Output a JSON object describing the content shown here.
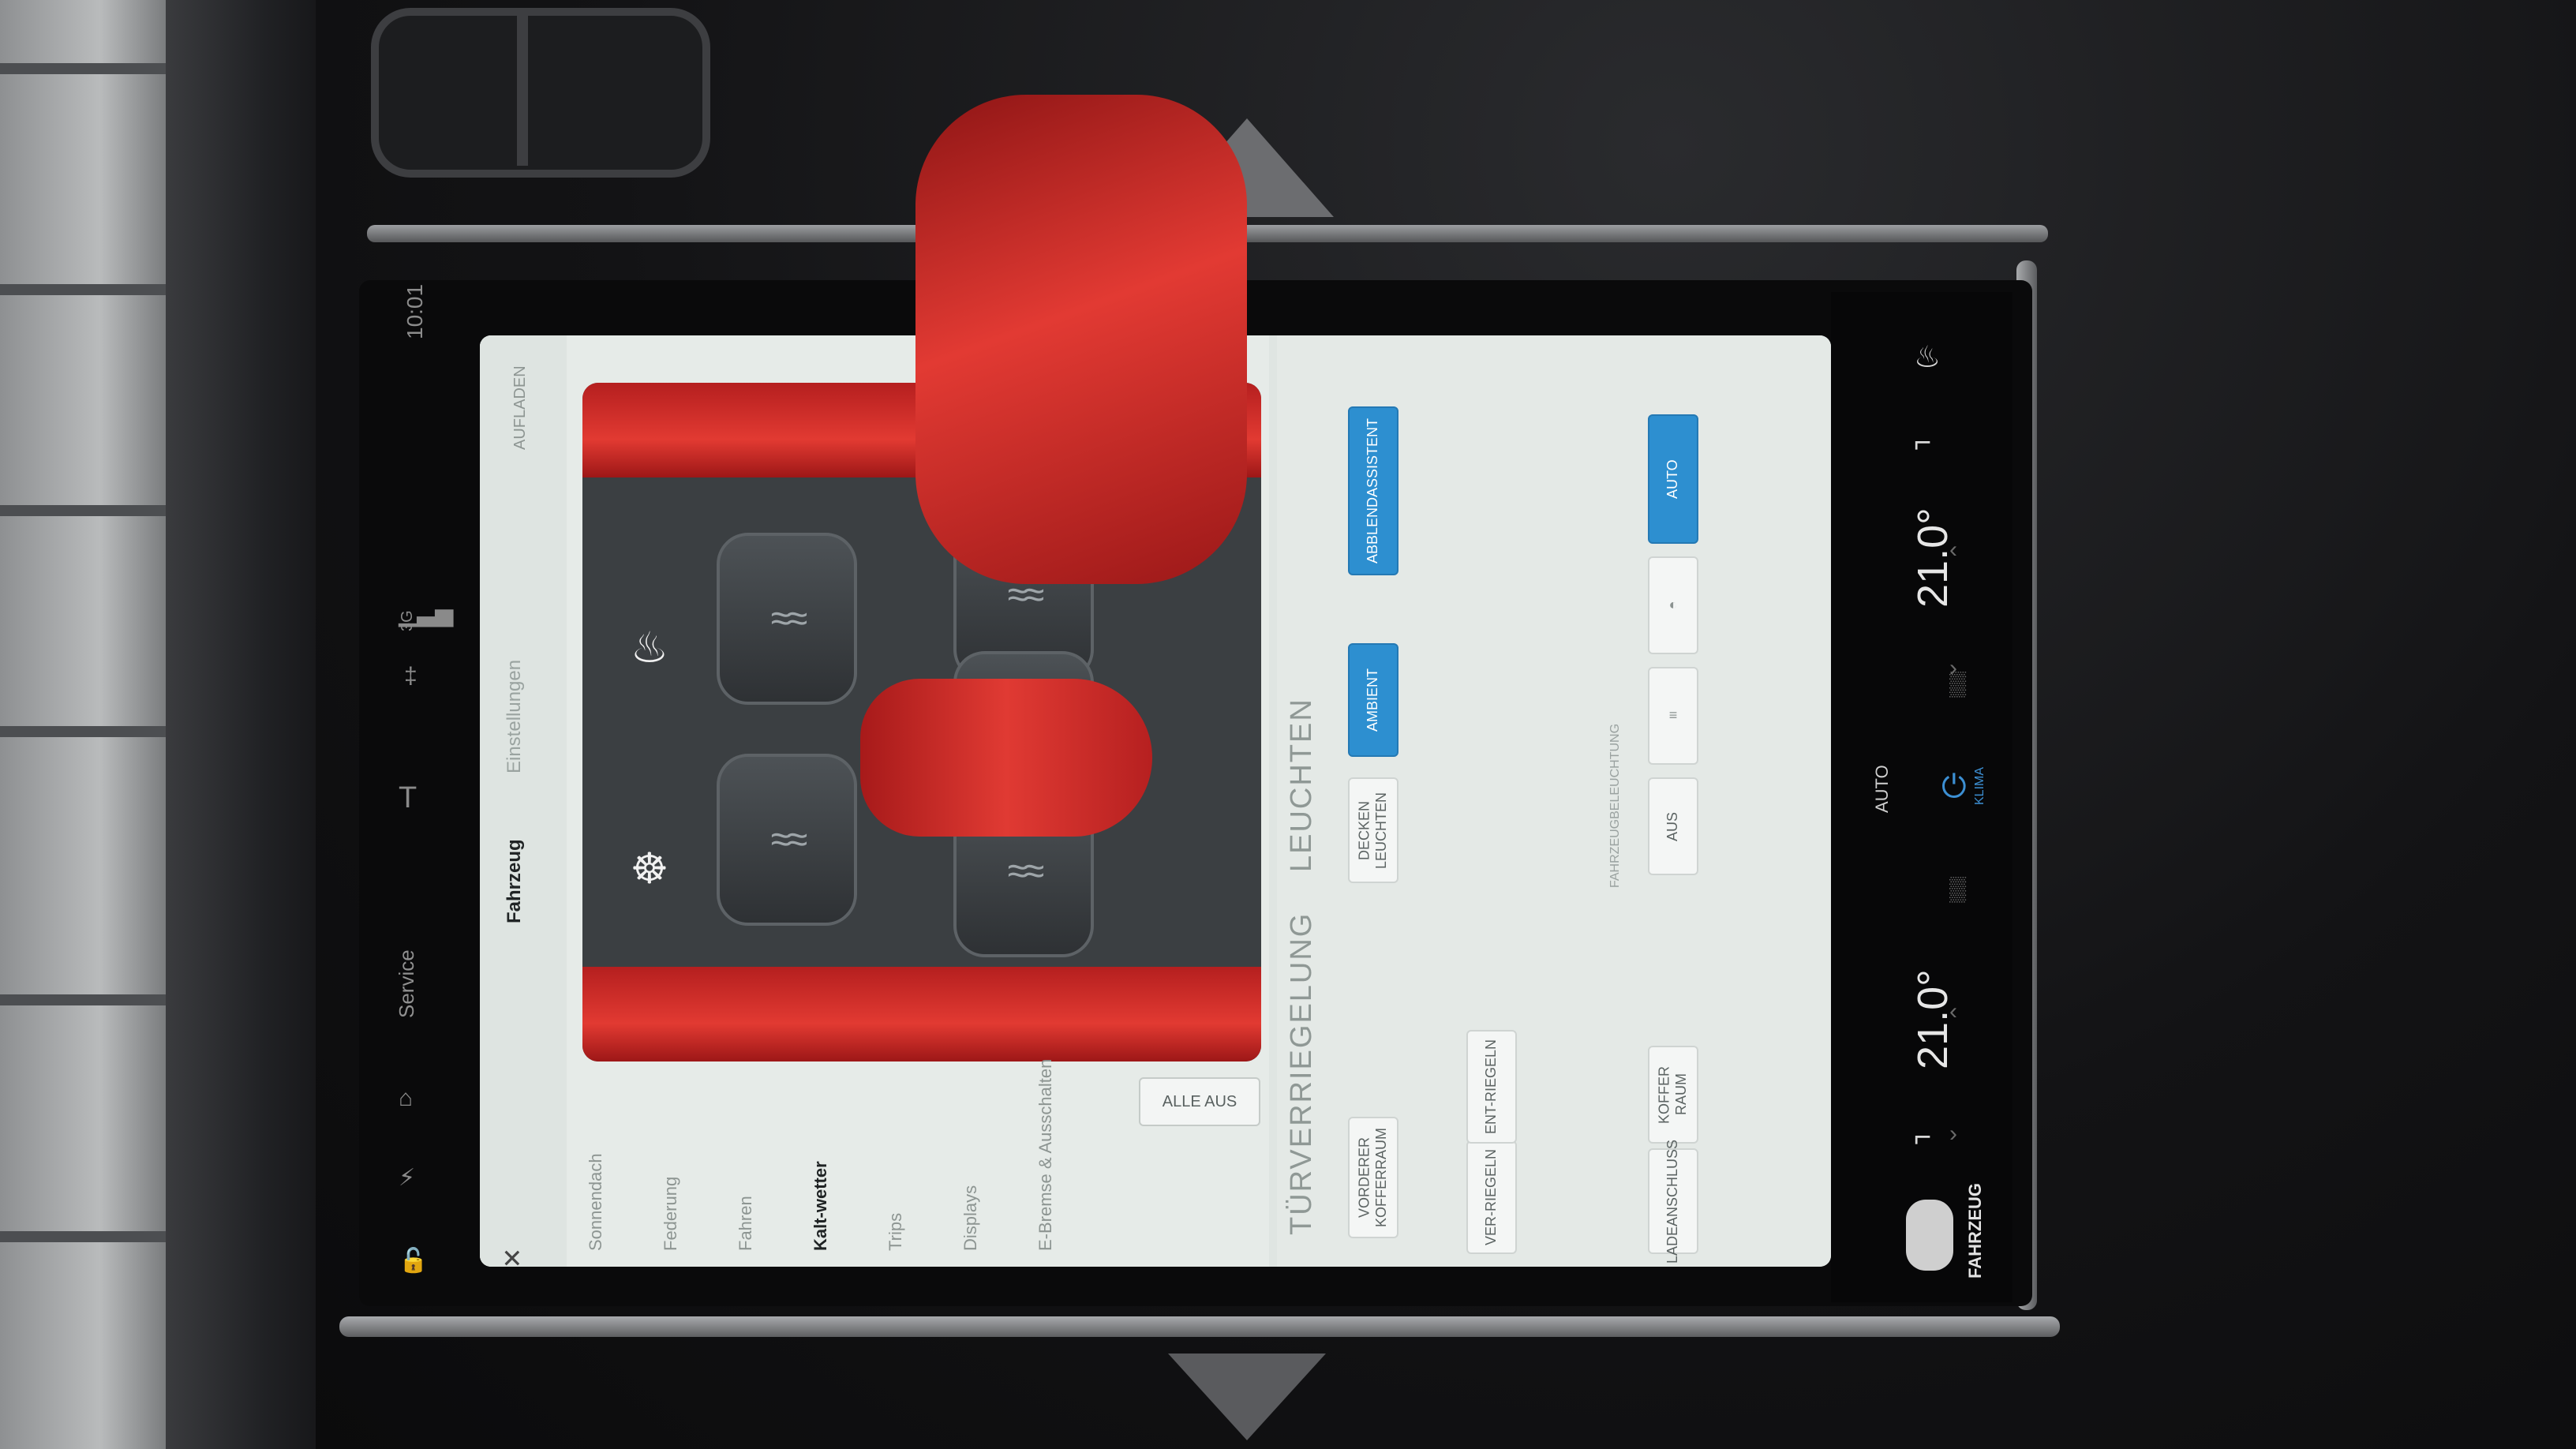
{
  "status_bar": {
    "time": "10:01",
    "network": "3G",
    "service_label": "Service"
  },
  "app": {
    "tabs": [
      {
        "label": "Fahrzeug",
        "active": true
      },
      {
        "label": "Einstellungen",
        "active": false
      }
    ],
    "charge_button": "AUFLADEN",
    "close_icon": "close-icon",
    "alle_aus": "ALLE AUS",
    "side_menu": [
      {
        "label": "Sonnendach",
        "active": false
      },
      {
        "label": "Federung",
        "active": false
      },
      {
        "label": "Fahren",
        "active": false
      },
      {
        "label": "Kalt-wetter",
        "active": true
      },
      {
        "label": "Trips",
        "active": false
      },
      {
        "label": "Displays",
        "active": false
      },
      {
        "label": "E-Bremse & Ausschalten",
        "active": false
      }
    ]
  },
  "locking": {
    "title": "TÜRVERRIEGELUNG",
    "buttons": {
      "front_trunk": "VORDERER KOFFERRAUM",
      "lock": "VER-RIEGELN",
      "unlock": "ENT-RIEGELN",
      "trunk": "KOFFER RAUM",
      "charge_port": "LADEANSCHLUSS"
    }
  },
  "lights": {
    "title": "LEUCHTEN",
    "buttons": {
      "ceiling": "DECKEN LEUCHTEN",
      "ambient": "AMBIENT",
      "dimming_assist": "ABBLENDASSISTENT",
      "off": "AUS",
      "auto": "AUTO"
    },
    "caption": "FAHRZEUGBELEUCHTUNG"
  },
  "climate": {
    "left_temp": "21.0°",
    "right_temp": "21.0°",
    "fan_mode": "AUTO",
    "klima_label": "KLIMA",
    "vehicle_label": "FAHRZEUG"
  },
  "colors": {
    "accent_blue": "#2d8fd0",
    "car_red": "#e23a33"
  }
}
